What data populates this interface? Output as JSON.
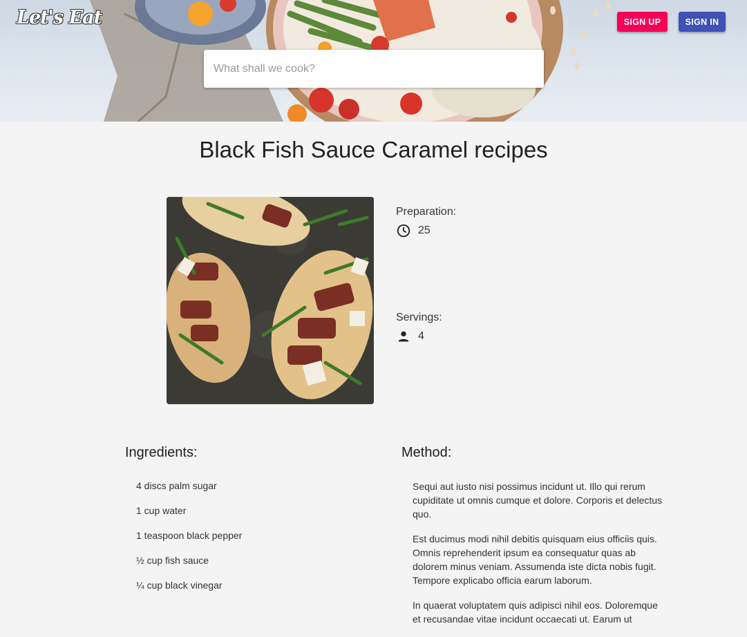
{
  "header": {
    "logo": "Let's Eat",
    "signup_label": "SIGN UP",
    "signin_label": "SIGN IN",
    "search_placeholder": "What shall we cook?",
    "signup_color": "#f50057",
    "signin_color": "#3f51b5"
  },
  "recipe": {
    "title": "Black Fish Sauce Caramel recipes",
    "preparation_label": "Preparation:",
    "preparation_value": "25",
    "preparation_icon": "clock-icon",
    "servings_label": "Servings:",
    "servings_value": "4",
    "servings_icon": "person-icon"
  },
  "ingredients": {
    "heading": "Ingredients:",
    "items": [
      "4 discs palm sugar",
      "1 cup water",
      "1 teaspoon black pepper",
      "½ cup fish sauce",
      "¼ cup black vinegar"
    ]
  },
  "method": {
    "heading": "Method:",
    "paragraphs": [
      "Sequi aut iusto nisi possimus incidunt ut. Illo qui rerum cupiditate ut omnis cumque et dolore. Corporis et delectus quo.",
      "Est ducimus modi nihil debitis quisquam eius officiis quis. Omnis reprehenderit ipsum ea consequatur quas ab dolorem minus veniam. Assumenda iste dicta nobis fugit. Tempore explicabo officia earum laborum.",
      "In quaerat voluptatem quis adipisci nihil eos. Doloremque et recusandae vitae incidunt occaecati ut. Earum ut"
    ]
  }
}
